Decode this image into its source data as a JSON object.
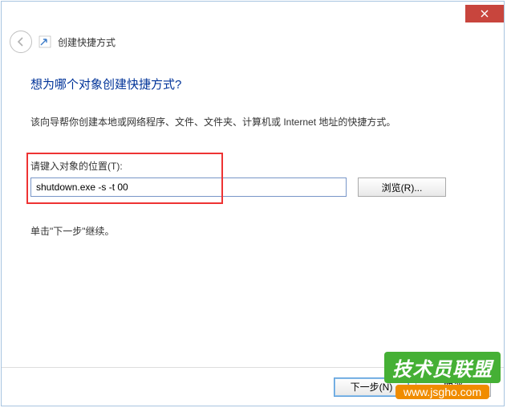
{
  "window": {
    "title": "创建快捷方式"
  },
  "content": {
    "heading": "想为哪个对象创建快捷方式?",
    "description": "该向导帮你创建本地或网络程序、文件、文件夹、计算机或 Internet 地址的快捷方式。",
    "field_label": "请键入对象的位置(T):",
    "input_value": "shutdown.exe -s -t 00",
    "browse_label": "浏览(R)...",
    "instruction": "单击\"下一步\"继续。"
  },
  "footer": {
    "next_label": "下一步(N)",
    "cancel_label": "取消"
  },
  "watermark": {
    "top": "技术员联盟",
    "bottom": "www.jsgho.com"
  }
}
